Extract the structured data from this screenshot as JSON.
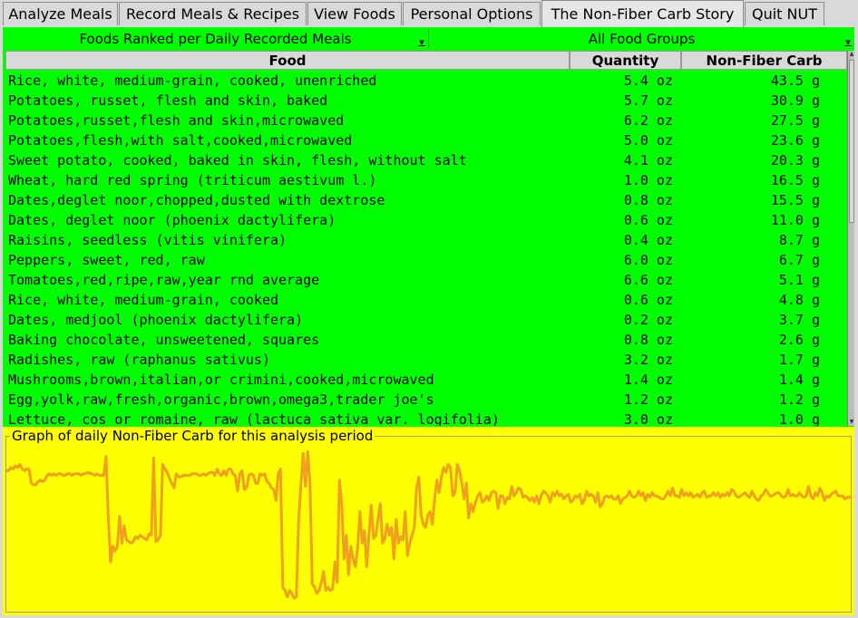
{
  "tabs": [
    {
      "label": "Analyze Meals",
      "active": false
    },
    {
      "label": "Record Meals & Recipes",
      "active": false
    },
    {
      "label": "View Foods",
      "active": false
    },
    {
      "label": "Personal Options",
      "active": false
    },
    {
      "label": "The Non-Fiber Carb Story",
      "active": true
    },
    {
      "label": "Quit NUT",
      "active": false
    }
  ],
  "selectors": {
    "ranking": "Foods Ranked per Daily Recorded Meals",
    "group": "All Food Groups"
  },
  "table": {
    "columns": [
      "Food",
      "Quantity",
      "Non-Fiber Carb"
    ],
    "rows": [
      {
        "food": "Rice, white, medium-grain, cooked, unenriched",
        "qty": "5.4 oz",
        "carb": "43.5 g"
      },
      {
        "food": "Potatoes, russet, flesh and skin, baked",
        "qty": "5.7 oz",
        "carb": "30.9 g"
      },
      {
        "food": "Potatoes,russet,flesh and skin,microwaved",
        "qty": "6.2 oz",
        "carb": "27.5 g"
      },
      {
        "food": "Potatoes,flesh,with salt,cooked,microwaved",
        "qty": "5.0 oz",
        "carb": "23.6 g"
      },
      {
        "food": "Sweet potato, cooked, baked in skin, flesh, without salt",
        "qty": "4.1 oz",
        "carb": "20.3 g"
      },
      {
        "food": "Wheat, hard red spring (triticum aestivum l.)",
        "qty": "1.0 oz",
        "carb": "16.5 g"
      },
      {
        "food": "Dates,deglet noor,chopped,dusted with dextrose",
        "qty": "0.8 oz",
        "carb": "15.5 g"
      },
      {
        "food": "Dates, deglet noor (phoenix dactylifera)",
        "qty": "0.6 oz",
        "carb": "11.0 g"
      },
      {
        "food": "Raisins, seedless (vitis vinifera)",
        "qty": "0.4 oz",
        "carb": "8.7 g"
      },
      {
        "food": "Peppers, sweet, red, raw",
        "qty": "6.0 oz",
        "carb": "6.7 g"
      },
      {
        "food": "Tomatoes,red,ripe,raw,year rnd average",
        "qty": "6.6 oz",
        "carb": "5.1 g"
      },
      {
        "food": "Rice, white, medium-grain, cooked",
        "qty": "0.6 oz",
        "carb": "4.8 g"
      },
      {
        "food": "Dates, medjool (phoenix dactylifera)",
        "qty": "0.2 oz",
        "carb": "3.7 g"
      },
      {
        "food": "Baking chocolate, unsweetened, squares",
        "qty": "0.8 oz",
        "carb": "2.6 g"
      },
      {
        "food": "Radishes, raw (raphanus sativus)",
        "qty": "3.2 oz",
        "carb": "1.7 g"
      },
      {
        "food": "Mushrooms,brown,italian,or crimini,cooked,microwaved",
        "qty": "1.4 oz",
        "carb": "1.4 g"
      },
      {
        "food": "Egg,yolk,raw,fresh,organic,brown,omega3,trader joe's",
        "qty": "1.2 oz",
        "carb": "1.2 g"
      },
      {
        "food": "Lettuce, cos or romaine, raw (lactuca sativa var. logifolia)",
        "qty": "3.0 oz",
        "carb": "1.0 g"
      }
    ]
  },
  "graph": {
    "title": "Graph of daily Non-Fiber Carb for this analysis period",
    "line_color": "#f0a020",
    "series": [
      14,
      14,
      12,
      13,
      11,
      12,
      10,
      13,
      14,
      13,
      13,
      22,
      23,
      23,
      21,
      20,
      21,
      20,
      17,
      16,
      17,
      16,
      17,
      16,
      16,
      17,
      17,
      16,
      16,
      17,
      16,
      16,
      16,
      17,
      16,
      16,
      15,
      16,
      16,
      17,
      16,
      17,
      17,
      17,
      5,
      43,
      72,
      62,
      65,
      62,
      43,
      60,
      49,
      58,
      59,
      60,
      59,
      56,
      57,
      55,
      56,
      57,
      58,
      54,
      55,
      6,
      59,
      58,
      55,
      10,
      13,
      15,
      19,
      22,
      25,
      16,
      18,
      18,
      17,
      17,
      17,
      17,
      16,
      16,
      16,
      17,
      17,
      16,
      17,
      16,
      15,
      15,
      17,
      13,
      16,
      17,
      14,
      17,
      13,
      13,
      16,
      17,
      27,
      16,
      14,
      26,
      25,
      17,
      16,
      17,
      22,
      22,
      16,
      17,
      16,
      21,
      22,
      25,
      26,
      33,
      16,
      13,
      88,
      90,
      94,
      90,
      92,
      95,
      94,
      45,
      23,
      3,
      24,
      2,
      22,
      86,
      88,
      92,
      90,
      85,
      78,
      90,
      88,
      90,
      89,
      72,
      85,
      20,
      35,
      70,
      55,
      80,
      62,
      70,
      75,
      63,
      40,
      60,
      52,
      75,
      55,
      36,
      57,
      55,
      45,
      35,
      60,
      57,
      48,
      55,
      50,
      70,
      45,
      60,
      56,
      58,
      40,
      68,
      60,
      55,
      50,
      25,
      18,
      42,
      48,
      50,
      42,
      40,
      48,
      32,
      20,
      28,
      18,
      12,
      15,
      10,
      12,
      30,
      28,
      10,
      14,
      22,
      32,
      22,
      44,
      35,
      40,
      34,
      30,
      28,
      34,
      33,
      30,
      33,
      28,
      27,
      28,
      38,
      30,
      30,
      35,
      31,
      32,
      24,
      30,
      28,
      25,
      26,
      31,
      30,
      31,
      33,
      31,
      34,
      30,
      35,
      30,
      27,
      28,
      30,
      34,
      28,
      30,
      27,
      30,
      29,
      32,
      30,
      29,
      34,
      33,
      30,
      31,
      29,
      35,
      33,
      27,
      30,
      29,
      30,
      34,
      28,
      37,
      35,
      31,
      30,
      31,
      30,
      32,
      32,
      30,
      35,
      32,
      31,
      30,
      27,
      30,
      31,
      30,
      27,
      30,
      28,
      33,
      29,
      31,
      28,
      30,
      30,
      31,
      32,
      32,
      30,
      27,
      30,
      25,
      30,
      30,
      31,
      26,
      30,
      28,
      30,
      28,
      31,
      30,
      29,
      31,
      28,
      27,
      31,
      30,
      30,
      28,
      30,
      28,
      31,
      29,
      30,
      28,
      30,
      26,
      27,
      30,
      31,
      30,
      29,
      28,
      30,
      31,
      27,
      30,
      32,
      33,
      30,
      29,
      26,
      28,
      30,
      30,
      29,
      28,
      28,
      30,
      31,
      30,
      26,
      30,
      29,
      30,
      30,
      28,
      30,
      31,
      30,
      24,
      30,
      32,
      28,
      30,
      25,
      28,
      33,
      30,
      31,
      29,
      28,
      27,
      30,
      30,
      30,
      32,
      31,
      31,
      30
    ]
  }
}
